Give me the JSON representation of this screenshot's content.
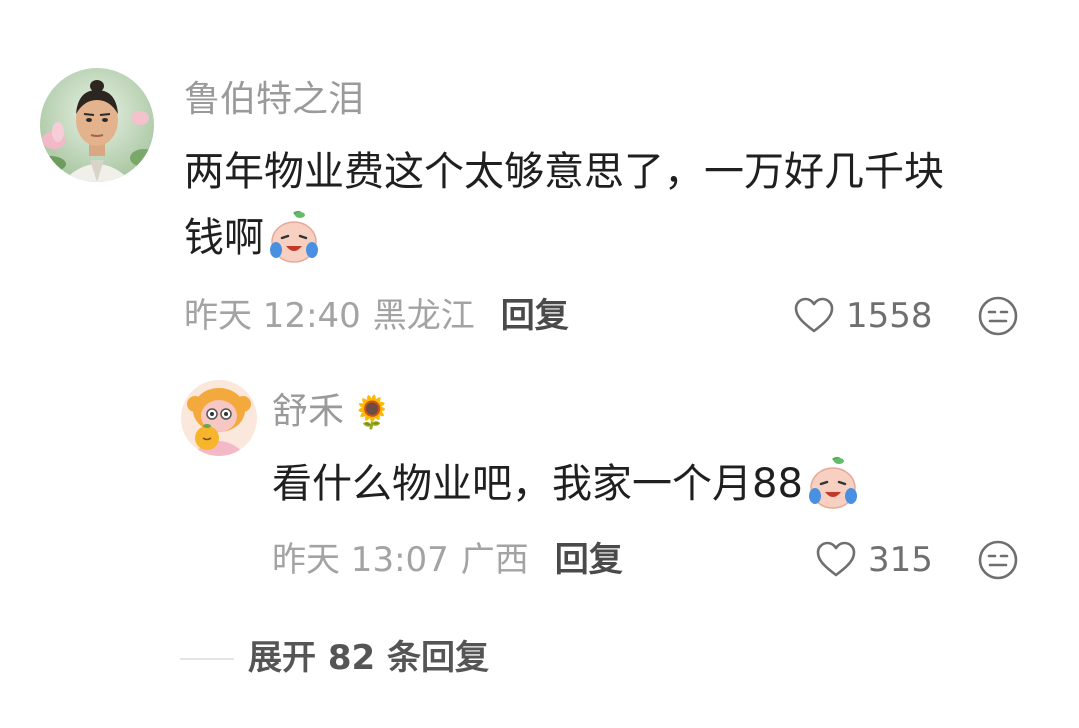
{
  "comment": {
    "username": "鲁伯特之泪",
    "text_line1": "两年物业费这个太够意思了，一万好几千块",
    "text_line2": "钱啊",
    "emoji_icon": "crying-laughing-emoji-icon",
    "time": "昨天 12:40",
    "location": "黑龙江",
    "reply_label": "回复",
    "likes": "1558"
  },
  "reply": {
    "username": "舒禾",
    "name_emoji": "🌻",
    "text": "看什么物业吧，我家一个月88",
    "emoji_icon": "crying-laughing-emoji-icon",
    "time": "昨天 13:07",
    "location": "广西",
    "reply_label": "回复",
    "likes": "315"
  },
  "expand": {
    "label": "展开 82 条回复"
  },
  "colors": {
    "username": "#9a9a9a",
    "body": "#1f1f1f",
    "meta": "#a3a3a3",
    "icon": "#6f6f6f"
  }
}
